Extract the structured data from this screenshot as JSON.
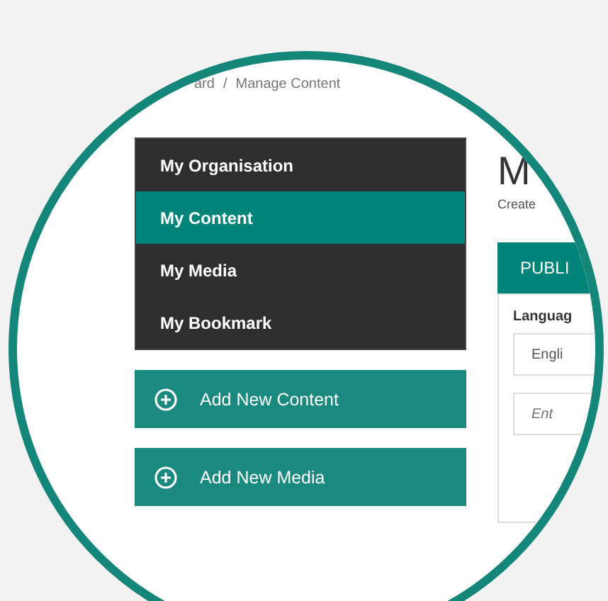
{
  "breadcrumb": {
    "items": [
      "ard",
      "Manage Content"
    ],
    "separator": "/"
  },
  "menu": [
    {
      "label": "My Organisation",
      "selected": false
    },
    {
      "label": "My Content",
      "selected": true
    },
    {
      "label": "My Media",
      "selected": false
    },
    {
      "label": "My Bookmark",
      "selected": false
    }
  ],
  "actions": [
    "Add New Content",
    "Add New Media"
  ],
  "page": {
    "title": "M",
    "subtitle": "Create",
    "panel_title": "PUBLI",
    "language_label": "Languag",
    "language_value": "Engli",
    "input_placeholder": "Ent"
  }
}
